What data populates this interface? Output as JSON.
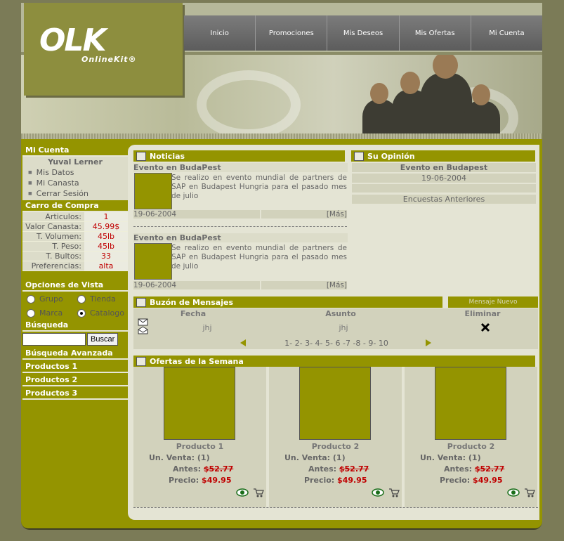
{
  "brand": {
    "logo": "OLK",
    "sub": "OnlineKit®"
  },
  "nav": [
    "Inicio",
    "Promociones",
    "Mis Deseos",
    "Mis Ofertas",
    "Mi Cuenta"
  ],
  "sidebar": {
    "account_title": "Mi Cuenta",
    "user": "Yuval Lerner",
    "account_links": [
      "Mis Datos",
      "Mi Canasta",
      "Cerrar Sesión"
    ],
    "cart_title": "Carro de Compra",
    "cart": [
      {
        "label": "Articulos:",
        "value": "1"
      },
      {
        "label": "Valor Canasta:",
        "value": "45.99$"
      },
      {
        "label": "T. Volumen:",
        "value": "45lb"
      },
      {
        "label": "T. Peso:",
        "value": "45lb"
      },
      {
        "label": "T. Bultos:",
        "value": "33"
      },
      {
        "label": "Preferencias:",
        "value": "alta"
      }
    ],
    "view_title": "Opciones de Vista",
    "view_options": [
      {
        "label": "Grupo",
        "checked": false
      },
      {
        "label": "Tienda",
        "checked": false
      },
      {
        "label": "Marca",
        "checked": false
      },
      {
        "label": "Catalogo",
        "checked": true
      }
    ],
    "search_title": "Búsqueda",
    "search_value": "",
    "search_button": "Buscar",
    "adv_search": "Búsqueda Avanzada",
    "products": [
      "Productos 1",
      "Productos 2",
      "Productos 3"
    ]
  },
  "news": {
    "title": "Noticias",
    "items": [
      {
        "heading": "Evento en BudaPest",
        "body": "Se realizo en evento mundial de partners de SAP en Budapest Hungria para el pasado mes de julio",
        "date": "19-06-2004",
        "more": "[Más]"
      },
      {
        "heading": "Evento en BudaPest",
        "body": "Se realizo en evento mundial de partners de SAP en Budapest Hungria para el pasado mes de julio",
        "date": "19-06-2004",
        "more": "[Más]"
      }
    ]
  },
  "opinion": {
    "title": "Su Opinión",
    "heading": "Evento en Budapest",
    "date": "19-06-2004",
    "blank": "",
    "previous": "Encuestas Anteriores"
  },
  "messages": {
    "title": "Buzón de Mensajes",
    "new_link": "Mensaje Nuevo",
    "columns": [
      "Fecha",
      "Asunto",
      "Eliminar"
    ],
    "rows": [
      {
        "fecha": "jhj",
        "asunto": "jhj"
      }
    ],
    "pages": "1- 2- 3- 4- 5- 6 -7 -8 - 9- 10"
  },
  "offers": {
    "title": "Ofertas de la Semana",
    "items": [
      {
        "name": "Producto 1",
        "unit_label": "Un. Venta:",
        "unit": "(1)",
        "before_label": "Antes:",
        "before": "$52.77",
        "price_label": "Precio:",
        "price": "$49.95"
      },
      {
        "name": "Producto 2",
        "unit_label": "Un. Venta:",
        "unit": "(1)",
        "before_label": "Antes:",
        "before": "$52.77",
        "price_label": "Precio:",
        "price": "$49.95"
      },
      {
        "name": "Producto 2",
        "unit_label": "Un. Venta:",
        "unit": "(1)",
        "before_label": "Antes:",
        "before": "$52.77",
        "price_label": "Precio:",
        "price": "$49.95"
      }
    ]
  },
  "colors": {
    "accent": "#949400",
    "panel": "#e4e4d4",
    "price": "#c00000"
  },
  "icons": [
    "note-icon",
    "opinion-icon",
    "mail-icon",
    "offers-icon",
    "mail-closed-icon",
    "mail-open-icon",
    "delete-x-icon",
    "prev-arrow-icon",
    "next-arrow-icon",
    "view-eye-icon",
    "cart-icon"
  ]
}
